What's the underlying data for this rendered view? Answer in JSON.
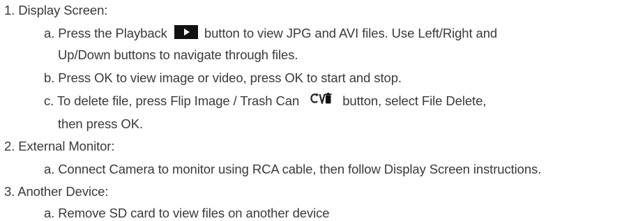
{
  "items": [
    {
      "heading": "1. Display Screen:",
      "sub": [
        {
          "text1": "a. Press the Playback ",
          "icon": "playback-icon",
          "text2": " button to view JPG and AVI files. Use Left/Right and",
          "cont": "Up/Down buttons to navigate through files."
        },
        {
          "text": "b. Press OK to view image or video, press OK to start and stop."
        },
        {
          "text1": "c. To delete file, press Flip Image / Trash Can ",
          "icon": "flip-trash-icon",
          "text2": " button, select File Delete,",
          "cont": "then press OK."
        }
      ]
    },
    {
      "heading": "2. External Monitor:",
      "sub": [
        {
          "text": "a. Connect Camera to monitor using RCA cable, then follow Display Screen instructions."
        }
      ]
    },
    {
      "heading": "3. Another Device:",
      "sub": [
        {
          "text": "a. Remove SD card to view files on another device"
        }
      ]
    }
  ]
}
